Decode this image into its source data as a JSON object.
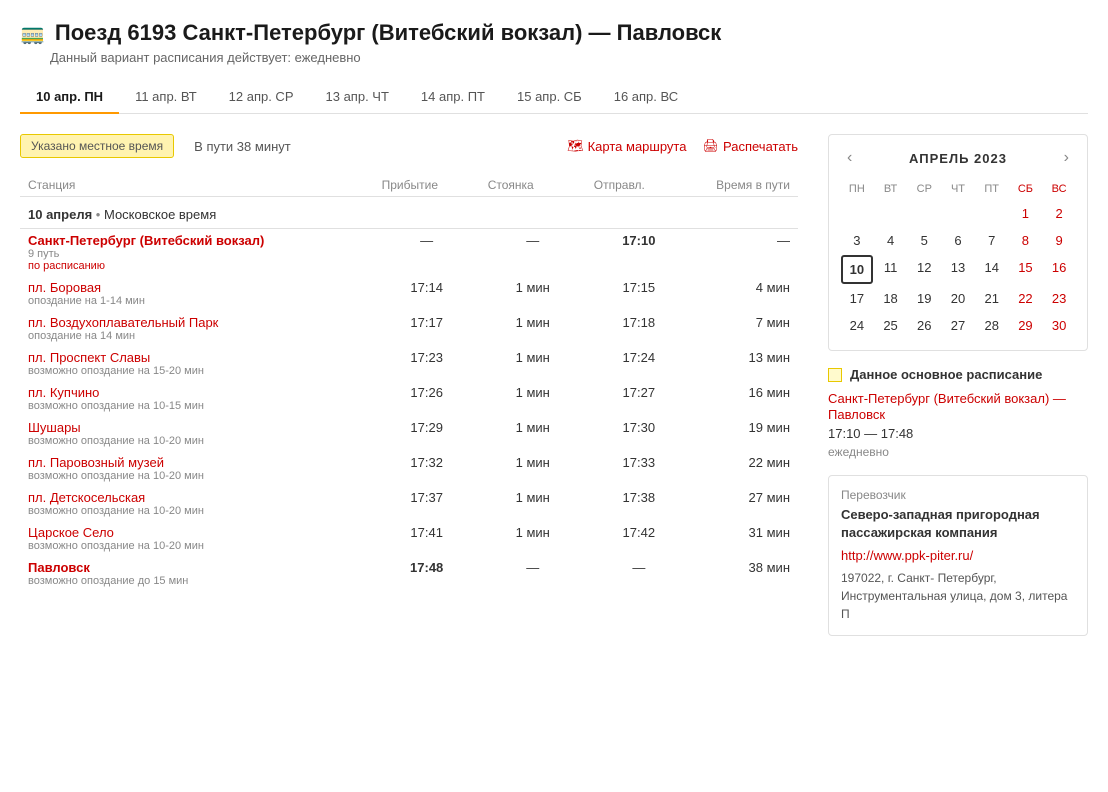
{
  "header": {
    "icon": "🚃",
    "title": "Поезд 6193 Санкт-Петербург (Витебский вокзал) — Павловск",
    "subtitle": "Данный вариант расписания действует: ежедневно"
  },
  "tabs": [
    {
      "label": "10 апр.",
      "day": "ПН",
      "active": true
    },
    {
      "label": "11 апр.",
      "day": "ВТ",
      "active": false
    },
    {
      "label": "12 апр.",
      "day": "СР",
      "active": false
    },
    {
      "label": "13 апр.",
      "day": "ЧТ",
      "active": false
    },
    {
      "label": "14 апр.",
      "day": "ПТ",
      "active": false
    },
    {
      "label": "15 апр.",
      "day": "СБ",
      "active": false
    },
    {
      "label": "16 апр.",
      "day": "ВС",
      "active": false
    }
  ],
  "toolbar": {
    "local_time_badge": "Указано местное время",
    "travel_time": "В пути 38 минут",
    "map_link": "Карта маршрута",
    "print_link": "Распечатать"
  },
  "table_headers": {
    "station": "Станция",
    "arrival": "Прибытие",
    "stop": "Стоянка",
    "depart": "Отправл.",
    "travel": "Время в пути"
  },
  "date_row": {
    "date": "10 апреля",
    "timezone": "Московское время"
  },
  "stations": [
    {
      "name": "Санкт-Петербург (Витебский вокзал)",
      "bold": true,
      "note": "9 путь",
      "subnote": "по расписанию",
      "subnote_red": true,
      "arrival": "—",
      "stop": "—",
      "depart": "17:10",
      "depart_bold": true,
      "travel": "—"
    },
    {
      "name": "пл. Боровая",
      "bold": false,
      "note": "опоздание на 1-14 мин",
      "subnote": "",
      "subnote_red": false,
      "arrival": "17:14",
      "stop": "1 мин",
      "depart": "17:15",
      "depart_bold": false,
      "travel": "4 мин"
    },
    {
      "name": "пл. Воздухоплавательный Парк",
      "bold": false,
      "note": "опоздание на 14 мин",
      "subnote": "",
      "subnote_red": false,
      "arrival": "17:17",
      "stop": "1 мин",
      "depart": "17:18",
      "depart_bold": false,
      "travel": "7 мин"
    },
    {
      "name": "пл. Проспект Славы",
      "bold": false,
      "note": "возможно опоздание на 15-20 мин",
      "subnote": "",
      "subnote_red": false,
      "arrival": "17:23",
      "stop": "1 мин",
      "depart": "17:24",
      "depart_bold": false,
      "travel": "13 мин"
    },
    {
      "name": "пл. Купчино",
      "bold": false,
      "note": "возможно опоздание на 10-15 мин",
      "subnote": "",
      "subnote_red": false,
      "arrival": "17:26",
      "stop": "1 мин",
      "depart": "17:27",
      "depart_bold": false,
      "travel": "16 мин"
    },
    {
      "name": "Шушары",
      "bold": false,
      "note": "возможно опоздание на 10-20 мин",
      "subnote": "",
      "subnote_red": false,
      "arrival": "17:29",
      "stop": "1 мин",
      "depart": "17:30",
      "depart_bold": false,
      "travel": "19 мин"
    },
    {
      "name": "пл. Паровозный музей",
      "bold": false,
      "note": "возможно опоздание на 10-20 мин",
      "subnote": "",
      "subnote_red": false,
      "arrival": "17:32",
      "stop": "1 мин",
      "depart": "17:33",
      "depart_bold": false,
      "travel": "22 мин"
    },
    {
      "name": "пл. Детскосельская",
      "bold": false,
      "note": "возможно опоздание на 10-20 мин",
      "subnote": "",
      "subnote_red": false,
      "arrival": "17:37",
      "stop": "1 мин",
      "depart": "17:38",
      "depart_bold": false,
      "travel": "27 мин"
    },
    {
      "name": "Царское Село",
      "bold": false,
      "note": "возможно опоздание на 10-20 мин",
      "subnote": "",
      "subnote_red": false,
      "arrival": "17:41",
      "stop": "1 мин",
      "depart": "17:42",
      "depart_bold": false,
      "travel": "31 мин"
    },
    {
      "name": "Павловск",
      "bold": true,
      "note": "возможно опоздание до 15 мин",
      "subnote": "",
      "subnote_red": false,
      "arrival": "17:48",
      "arrival_bold": true,
      "stop": "—",
      "depart": "—",
      "depart_bold": false,
      "travel": "38 мин"
    }
  ],
  "calendar": {
    "title": "АПРЕЛЬ 2023",
    "days_headers": [
      "ПН",
      "ВТ",
      "СР",
      "ЧТ",
      "ПТ",
      "СБ",
      "ВС"
    ],
    "weeks": [
      [
        null,
        null,
        null,
        null,
        null,
        "1",
        "2"
      ],
      [
        "3",
        "4",
        "5",
        "6",
        "7",
        "8",
        "9"
      ],
      [
        "10",
        "11",
        "12",
        "13",
        "14",
        "15",
        "16"
      ],
      [
        "17",
        "18",
        "19",
        "20",
        "21",
        "22",
        "23"
      ],
      [
        "24",
        "25",
        "26",
        "27",
        "28",
        "29",
        "30"
      ]
    ],
    "today": "10",
    "red_days": [
      "1",
      "2",
      "8",
      "9",
      "15",
      "16",
      "22",
      "23",
      "29",
      "30"
    ]
  },
  "schedule_legend": {
    "label": "Данное основное расписание",
    "route": "Санкт-Петербург (Витебский вокзал) — Павловск",
    "times": "17:10 — 17:48",
    "freq": "ежедневно"
  },
  "carrier": {
    "label": "Перевозчик",
    "name": "Северо-западная пригородная пассажирская компания",
    "link": "http://www.ppk-piter.ru/",
    "address": "197022, г. Санкт- Петербург, Инструментальная улица, дом 3, литера П"
  }
}
